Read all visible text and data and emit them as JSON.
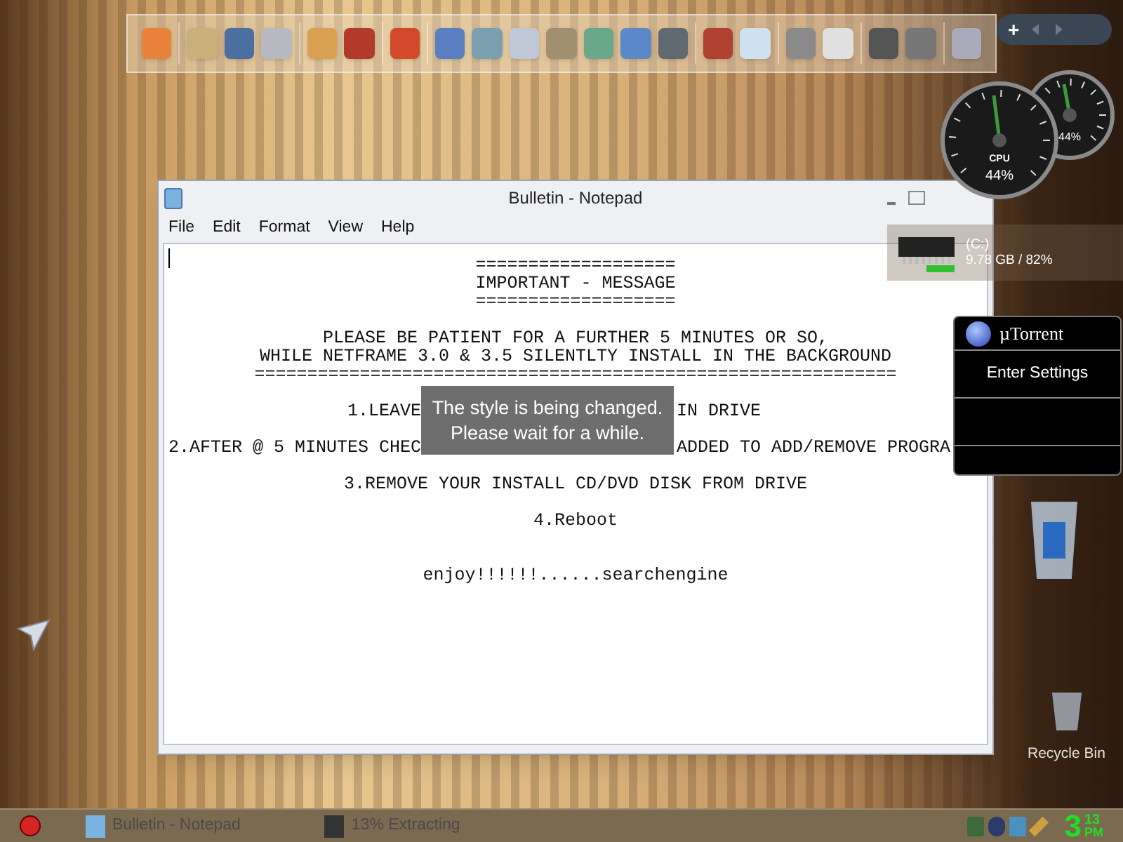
{
  "dock": {
    "add_button": "+"
  },
  "notepad": {
    "title": "Bulletin - Notepad",
    "menu": [
      "File",
      "Edit",
      "Format",
      "View",
      "Help"
    ],
    "lines": [
      {
        "kind": "line",
        "text": "==================="
      },
      {
        "kind": "line",
        "text": "IMPORTANT - MESSAGE"
      },
      {
        "kind": "line",
        "text": "==================="
      },
      {
        "kind": "para",
        "text": "PLEASE BE PATIENT FOR A FURTHER 5 MINUTES OR SO,"
      },
      {
        "kind": "line",
        "text": "WHILE NETFRAME 3.0 & 3.5 SILENTLTY INSTALL IN THE BACKGROUND"
      },
      {
        "kind": "line",
        "text": "============================================================="
      },
      {
        "kind": "split",
        "parts": [
          "1.LEAVE",
          "IN DRIVE"
        ]
      },
      {
        "kind": "split",
        "parts": [
          "2.AFTER @ 5 MINUTES CHEC",
          "ADDED TO ADD/REMOVE PROGRA"
        ]
      },
      {
        "kind": "para",
        "text": "3.REMOVE YOUR INSTALL CD/DVD DISK FROM DRIVE"
      },
      {
        "kind": "para",
        "text": "4.Reboot"
      },
      {
        "kind": "section",
        "text": "enjoy!!!!!!......searchengine"
      }
    ]
  },
  "overlay": [
    "The style is being changed.",
    "Please wait for a while."
  ],
  "gauges": {
    "cpu_label": "CPU",
    "cpu": "44%",
    "mem": "44%"
  },
  "drive": {
    "name": "(C:)",
    "usage": "9.78 GB / 82%"
  },
  "utorrent": {
    "title": "µTorrent",
    "items": [
      "Enter Settings"
    ]
  },
  "desktop_icons": [
    "Recycle Bin"
  ],
  "taskbar": {
    "items": [
      "Bulletin - Notepad",
      "13% Extracting"
    ],
    "clock": {
      "hour": "3",
      "minute": "13",
      "ampm": "PM"
    }
  }
}
